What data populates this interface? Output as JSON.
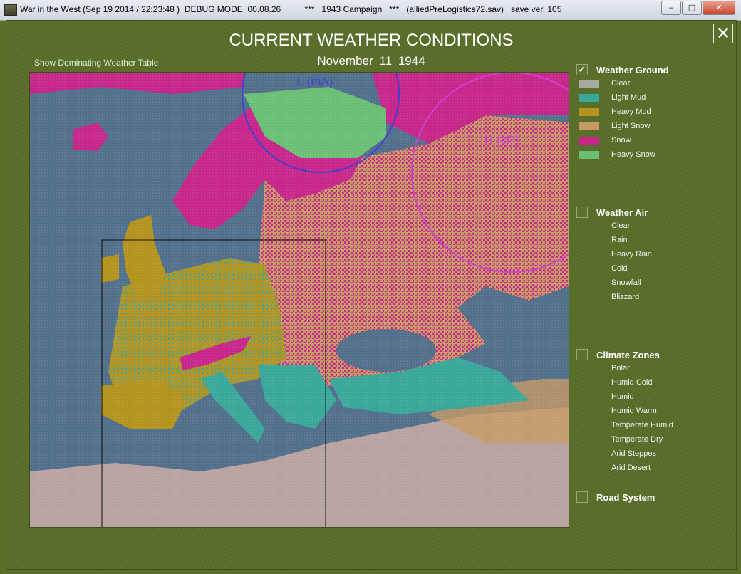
{
  "window": {
    "title": "War in the West (Sep 19 2014 / 22:23:48 )  DEBUG MODE  00.08.26          ***   1943 Campaign   ***   (alliedPreLogistics72.sav)   save ver. 105",
    "minimize_glyph": "‒",
    "maximize_glyph": "□",
    "close_glyph": "✕"
  },
  "screen": {
    "title": "CURRENT WEATHER CONDITIONS",
    "date": "November  11  1944",
    "dominating_link": "Show Dominating Weather Table",
    "close_glyph": "✕"
  },
  "map": {
    "low_pressure_label": "L (mA)",
    "high_pressure_label": "H (cP)",
    "low_color": "#4040d0",
    "high_color": "#d040d0"
  },
  "legend": {
    "weather_ground": {
      "label": "Weather Ground",
      "checked": true,
      "check_glyph": "✓",
      "items": [
        {
          "label": "Clear",
          "color": "#a6aca0"
        },
        {
          "label": "Light Mud",
          "color": "#3aa79b"
        },
        {
          "label": "Heavy Mud",
          "color": "#b5931f"
        },
        {
          "label": "Light Snow",
          "color": "#c59a64"
        },
        {
          "label": "Snow",
          "color": "#c7278a"
        },
        {
          "label": "Heavy Snow",
          "color": "#6bbf74"
        }
      ]
    },
    "weather_air": {
      "label": "Weather Air",
      "checked": false,
      "items": [
        "Clear",
        "Rain",
        "Heavy Rain",
        "Cold",
        "Snowfall",
        "Blizzard"
      ]
    },
    "climate_zones": {
      "label": "Climate Zones",
      "checked": false,
      "items": [
        "Polar",
        "Humid Cold",
        "Humid",
        "Humid Warm",
        "Temperate Humid",
        "Temperate Dry",
        "Arid Steppes",
        "Arid Desert"
      ]
    },
    "road_system": {
      "label": "Road System",
      "checked": false
    }
  }
}
